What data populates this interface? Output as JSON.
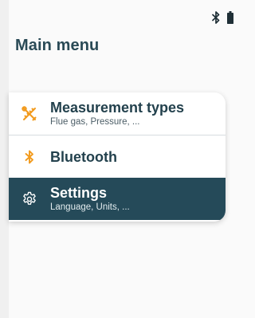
{
  "status_bar": {
    "icons": [
      "bluetooth-icon",
      "battery-icon"
    ]
  },
  "header": {
    "title": "Main menu"
  },
  "menu": {
    "items": [
      {
        "label": "Measurement types",
        "subtitle": "Flue gas, Pressure, ...",
        "icon": "measurement-tools-icon"
      },
      {
        "label": "Bluetooth",
        "subtitle": "",
        "icon": "bluetooth-icon"
      },
      {
        "label": "Settings",
        "subtitle": "Language, Units, ...",
        "icon": "gear-icon",
        "selected": true
      }
    ]
  },
  "colors": {
    "accent": "#f29a1c",
    "primary_dark": "#254a59",
    "title_text": "#2a4a56",
    "background": "#fafafa"
  }
}
